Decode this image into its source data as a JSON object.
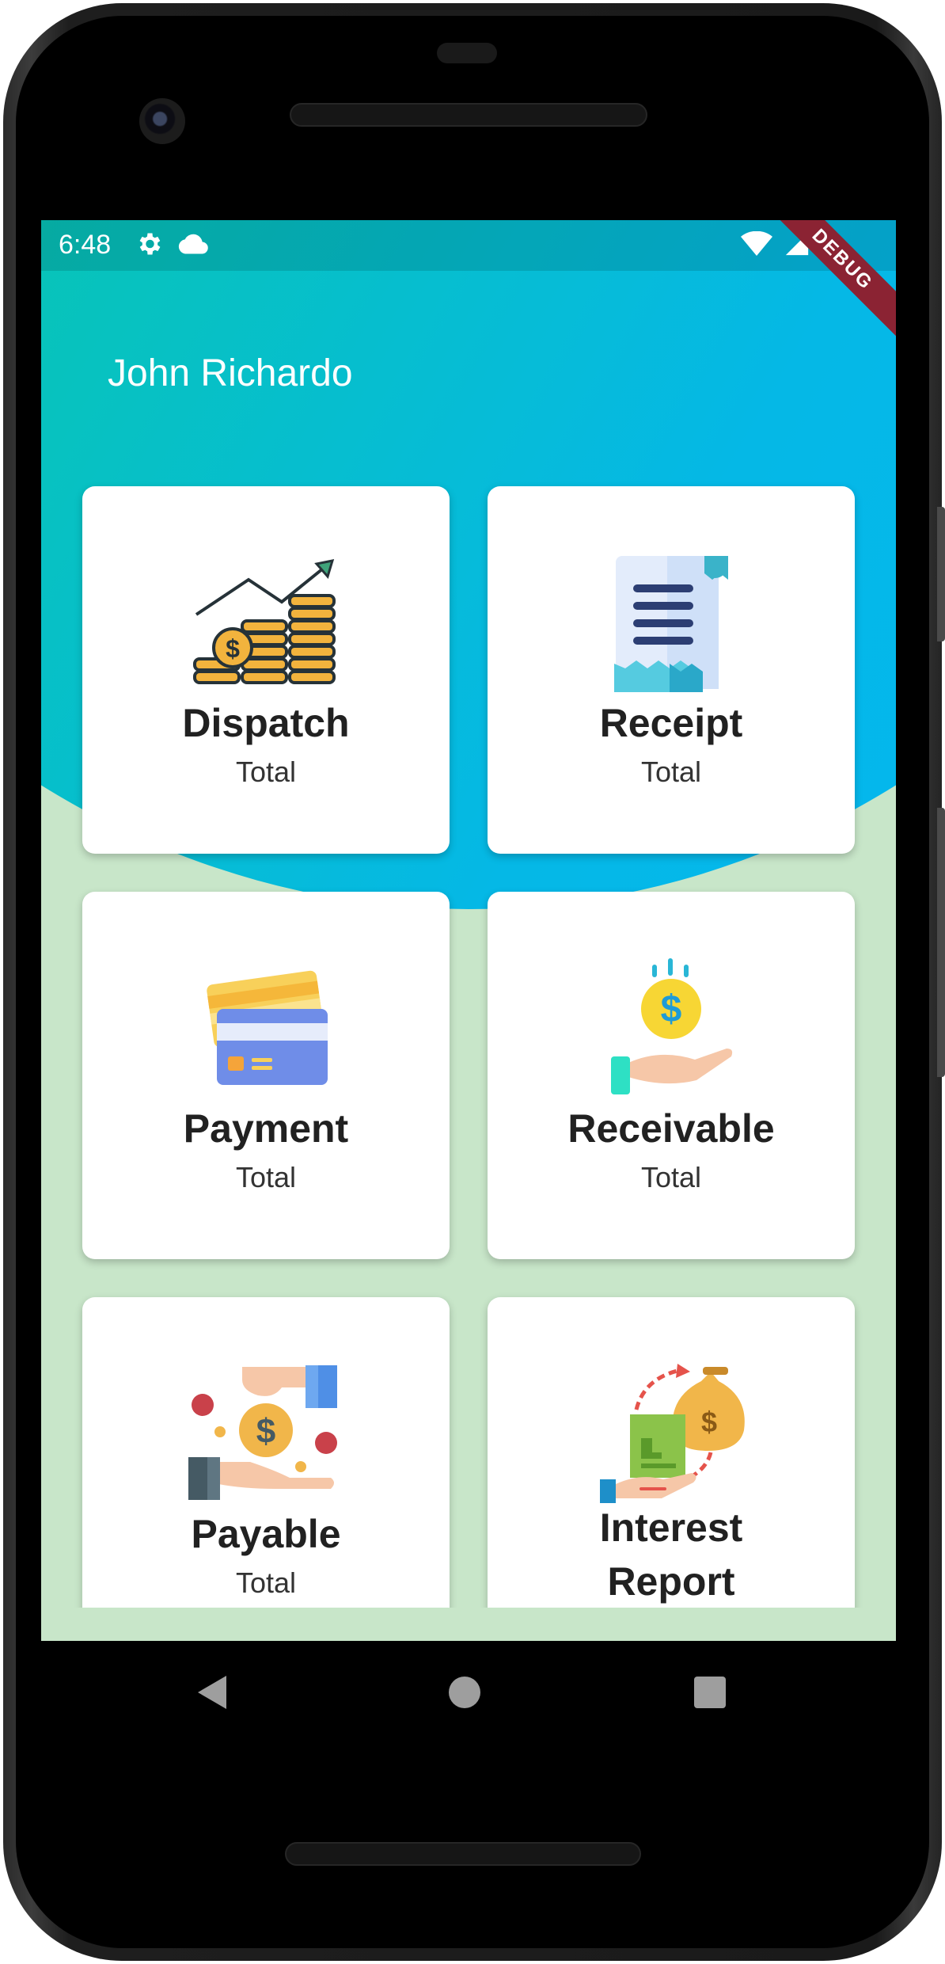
{
  "status_bar": {
    "time": "6:48",
    "icons_left": [
      "settings-icon",
      "cloud-icon"
    ],
    "icons_right": [
      "wifi-icon",
      "signal-icon",
      "battery-icon"
    ]
  },
  "debug_banner": "DEBUG",
  "header": {
    "user_name": "John Richardo"
  },
  "cards": [
    {
      "title": "Dispatch",
      "subtitle": "Total",
      "icon": "coins-growth-icon"
    },
    {
      "title": "Receipt",
      "subtitle": "Total",
      "icon": "receipt-icon"
    },
    {
      "title": "Payment",
      "subtitle": "Total",
      "icon": "credit-cards-icon"
    },
    {
      "title": "Receivable",
      "subtitle": "Total",
      "icon": "coin-hand-icon"
    },
    {
      "title": "Payable",
      "subtitle": "Total",
      "icon": "money-exchange-icon"
    },
    {
      "title": "Interest",
      "title_line2": "Report",
      "subtitle": "",
      "icon": "interest-report-icon"
    }
  ],
  "colors": {
    "header_start": "#1edc6e",
    "header_end": "#03b6f5",
    "background": "#c8e6c9",
    "card": "#ffffff"
  },
  "nav": [
    "back-icon",
    "home-icon",
    "recents-icon"
  ]
}
